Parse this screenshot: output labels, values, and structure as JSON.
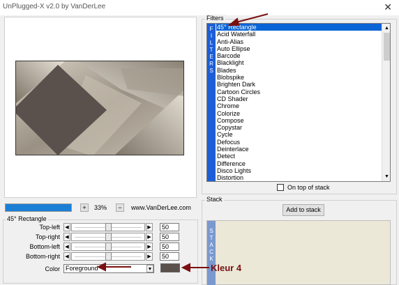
{
  "window": {
    "title": "UnPlugged-X v2.0 by VanDerLee",
    "close_glyph": "✕"
  },
  "preview": {
    "zoom": "33%",
    "minus": "−",
    "plus": "+",
    "website": "www.VanDerLee.com",
    "progress": 1.0
  },
  "params": {
    "group_label": "45° Rectangle",
    "sliders": [
      {
        "label": "Top-left",
        "value": "50",
        "fraction": 0.5
      },
      {
        "label": "Top-right",
        "value": "50",
        "fraction": 0.5
      },
      {
        "label": "Bottom-left",
        "value": "50",
        "fraction": 0.5
      },
      {
        "label": "Bottom-right",
        "value": "50",
        "fraction": 0.5
      }
    ],
    "color_label": "Color",
    "color_select": "Foreground",
    "swatch_color": "#5a504c"
  },
  "filters": {
    "group_label": "Filters",
    "vertical_label": [
      "F",
      "I",
      "L",
      "T",
      "E",
      "R",
      "S"
    ],
    "items": [
      "45° Rectangle",
      "Acid Waterfall",
      "Anti-Alias",
      "Auto Ellipse",
      "Barcode",
      "Blacklight",
      "Blades",
      "Blobspike",
      "Brighten Dark",
      "Cartoon Circles",
      "CD Shader",
      "Chrome",
      "Colorize",
      "Compose",
      "Copystar",
      "Cycle",
      "Defocus",
      "Deinterlace",
      "Detect",
      "Difference",
      "Disco Lights",
      "Distortion"
    ],
    "selected_index": 0,
    "on_top_label": "On top of stack"
  },
  "stack": {
    "group_label": "Stack",
    "add_button": "Add to stack",
    "vertical_label": [
      "S",
      "T",
      "A",
      "C",
      "K"
    ]
  },
  "annotation": {
    "text": "Kleur 4",
    "color": "#7a1010"
  }
}
